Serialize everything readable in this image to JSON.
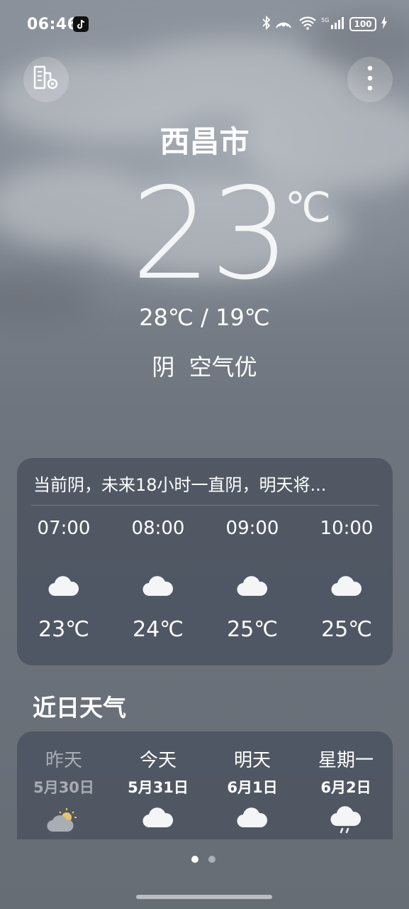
{
  "status_bar": {
    "time": "06:46",
    "battery": "100"
  },
  "header": {
    "city": "西昌市"
  },
  "current": {
    "temperature": "23",
    "unit": "℃",
    "range": "28℃ / 19℃",
    "condition": "阴  空气优"
  },
  "hourly": {
    "summary": "当前阴，未来18小时一直阴，明天将...",
    "items": [
      {
        "time": "07:00",
        "icon": "cloud-icon",
        "temp": "23℃"
      },
      {
        "time": "08:00",
        "icon": "cloud-icon",
        "temp": "24℃"
      },
      {
        "time": "09:00",
        "icon": "cloud-icon",
        "temp": "25℃"
      },
      {
        "time": "10:00",
        "icon": "cloud-icon",
        "temp": "25℃"
      }
    ]
  },
  "daily": {
    "title": "近日天气",
    "items": [
      {
        "name": "昨天",
        "date": "5月30日",
        "icon": "partly-sunny-icon"
      },
      {
        "name": "今天",
        "date": "5月31日",
        "icon": "cloud-icon"
      },
      {
        "name": "明天",
        "date": "6月1日",
        "icon": "cloud-icon"
      },
      {
        "name": "星期一",
        "date": "6月2日",
        "icon": "rain-cloud-icon"
      }
    ]
  },
  "pager": {
    "count": 2,
    "active": 0
  },
  "colors": {
    "card": "#4b525f",
    "sun": "#e8c46a"
  }
}
